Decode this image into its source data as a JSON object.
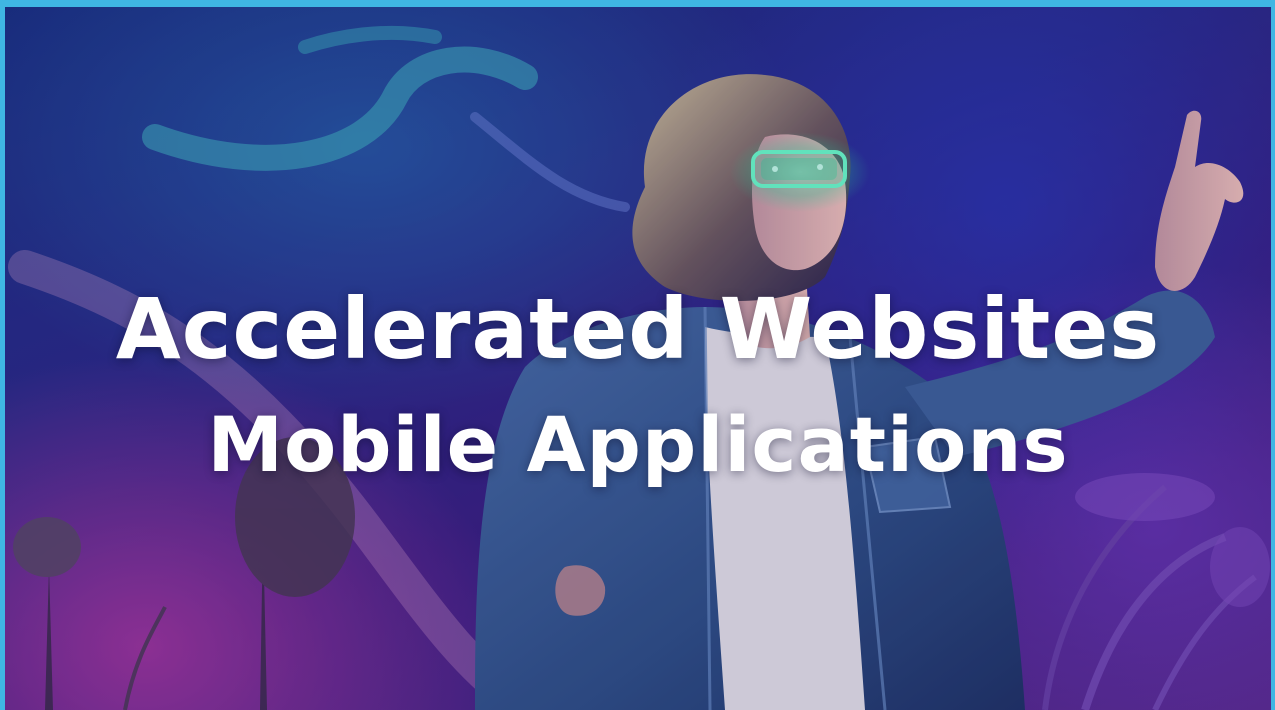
{
  "hero": {
    "headline_line_1": "Accelerated Websites",
    "headline_line_2": "Mobile Applications",
    "image_alt": "young man with glowing futuristic glasses pointing upward in neon-lit field",
    "colors": {
      "frame_border": "#3fb6e3",
      "text": "#ffffff",
      "glasses_glow": "#4dffc4",
      "jacket": "#3a5f9a",
      "shirt": "#e7e3ee"
    }
  }
}
